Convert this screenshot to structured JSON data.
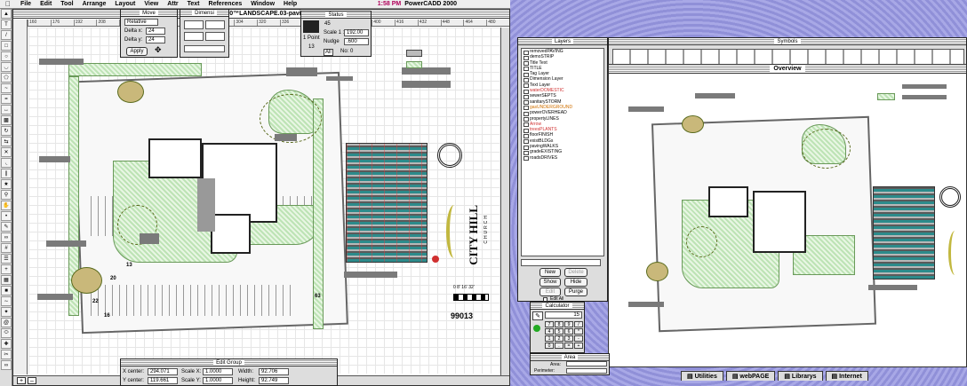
{
  "menubar": {
    "apple": "",
    "items": [
      "File",
      "Edit",
      "Tool",
      "Arrange",
      "Layout",
      "View",
      "Attr",
      "Text",
      "References",
      "Window",
      "Help"
    ],
    "clock": "1:58 PM",
    "app": "PowerCADD 2000"
  },
  "main_window": {
    "title": "C10™LANDSCAPE.03-pavi",
    "ruler_top": [
      "160",
      "176",
      "192",
      "208",
      "224",
      "240",
      "256",
      "272",
      "288",
      "304",
      "320",
      "336",
      "352",
      "368",
      "384",
      "400",
      "416",
      "432",
      "448",
      "464",
      "480"
    ],
    "plan_labels": {
      "n13": "13",
      "n20": "20",
      "n22": "22",
      "n16": "16",
      "n63": "63"
    },
    "logo_text": "CITY HILL",
    "logo_sub": "CHURCH",
    "sheet_number": "99013",
    "scale_bar": "0  8'  16'   32'"
  },
  "move_palette": {
    "title": "Move",
    "mode": "Relative",
    "delta_x_label": "Delta x:",
    "delta_x": "24",
    "delta_y_label": "Delta y:",
    "delta_y": "24",
    "apply": "Apply"
  },
  "dimension_palette": {
    "title": "Dimensi"
  },
  "status_palette": {
    "title": "Status",
    "scale_label": "Scale 1 :",
    "scale_value": "192.00",
    "nudge_label": "Nudge",
    "nudge_value": ".600",
    "pen_value": "45",
    "pen_width": "1 Point",
    "all_label": "All",
    "all_value": "No: 0",
    "count": "13"
  },
  "edit_group": {
    "title": "Edit Group",
    "xcenter_label": "X center:",
    "xcenter": "294.071",
    "ycenter_label": "Y center:",
    "ycenter": "119.661",
    "scalex_label": "Scale X:",
    "scalex": "1.0000",
    "scaley_label": "Scale Y:",
    "scaley": "1.0000",
    "width_label": "Width:",
    "width": "92.706",
    "height_label": "Height:",
    "height": "92.749"
  },
  "layers": {
    "title": "Layers",
    "items": [
      {
        "name": "removedPAVING",
        "color": "#000"
      },
      {
        "name": "demoSTRIP",
        "color": "#000"
      },
      {
        "name": "Title Text",
        "color": "#000"
      },
      {
        "name": "TITLE",
        "color": "#000"
      },
      {
        "name": "Tag Layer",
        "color": "#000"
      },
      {
        "name": "Dimension Layer",
        "color": "#000"
      },
      {
        "name": "Text Layer",
        "color": "#000"
      },
      {
        "name": "waterDOMESTIC",
        "color": "#d03030"
      },
      {
        "name": "sewerSEPTS",
        "color": "#000"
      },
      {
        "name": "sanitarySTORM",
        "color": "#000"
      },
      {
        "name": "gasUNDERGROUND",
        "color": "#d07000"
      },
      {
        "name": "powerOVERHEAD",
        "color": "#000"
      },
      {
        "name": "propertyLINES",
        "color": "#000"
      },
      {
        "name": "Arrow",
        "color": "#d03030"
      },
      {
        "name": "treesPLANTS",
        "color": "#d03030"
      },
      {
        "name": "floorFINISH",
        "color": "#000"
      },
      {
        "name": "existBLDGs",
        "color": "#000"
      },
      {
        "name": "pavingWALKS",
        "color": "#000"
      },
      {
        "name": "gradeEXISTING",
        "color": "#000"
      },
      {
        "name": "roadsDRIVES",
        "color": "#000"
      }
    ],
    "new": "New",
    "delete": "Delete",
    "show": "Show",
    "hide": "Hide",
    "edit": "Edit",
    "purge": "Purge",
    "edit_all": "Edit All"
  },
  "symbols": {
    "title": "Symbols"
  },
  "overview": {
    "title": "Overview"
  },
  "calculator": {
    "title": "Calculator",
    "display": "15",
    "keys": [
      "7",
      "8",
      "9",
      "/",
      "4",
      "5",
      "6",
      "*",
      "1",
      "2",
      "3",
      "-",
      "0",
      ".",
      "=",
      "+"
    ]
  },
  "area": {
    "title": "Area",
    "area_label": "Area:",
    "perimeter_label": "Perimeter:"
  },
  "desktop_tabs": [
    "Utilities",
    "webPAGE",
    "Librarys",
    "Internet"
  ],
  "colors": {
    "accent": "#b0005a",
    "desktop": "#9b9be0",
    "green": "#bde3b5"
  }
}
